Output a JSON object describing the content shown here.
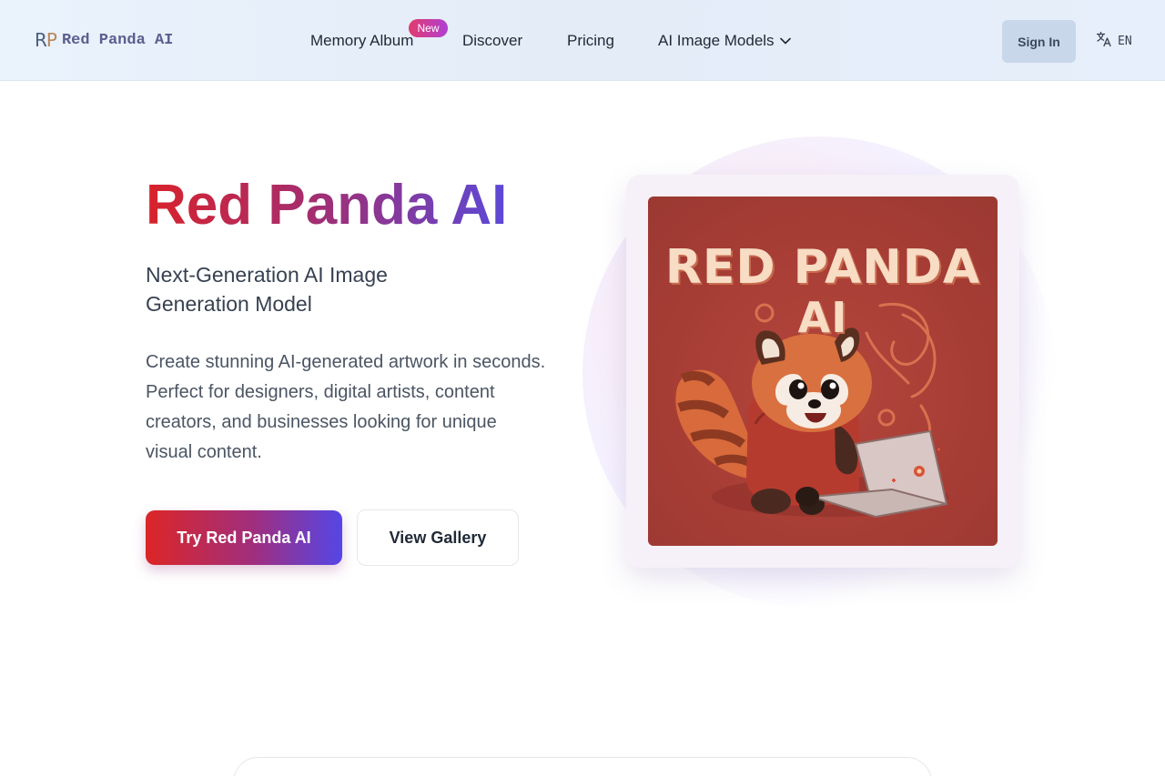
{
  "header": {
    "logo_mark_r": "R",
    "logo_mark_p": "P",
    "logo_text": "Red Panda AI",
    "nav": {
      "memory_album": "Memory Album",
      "new_badge": "New",
      "discover": "Discover",
      "pricing": "Pricing",
      "ai_image_models": "AI Image Models"
    },
    "sign_in": "Sign In",
    "language": "EN"
  },
  "hero": {
    "title": "Red Panda AI",
    "subtitle": "Next-Generation AI Image Generation Model",
    "description": "Create stunning AI-generated artwork in seconds. Perfect for designers, digital artists, content creators, and businesses looking for unique visual content.",
    "primary_button": "Try Red Panda AI",
    "secondary_button": "View Gallery"
  },
  "artwork": {
    "line1": "RED PANDA",
    "line2": "AI"
  },
  "colors": {
    "brand_red": "#dc2626",
    "brand_purple": "#5546e6",
    "artwork_background": "#a63d35"
  },
  "icons": {
    "language": "translate-icon",
    "dropdown": "chevron-down-icon"
  }
}
